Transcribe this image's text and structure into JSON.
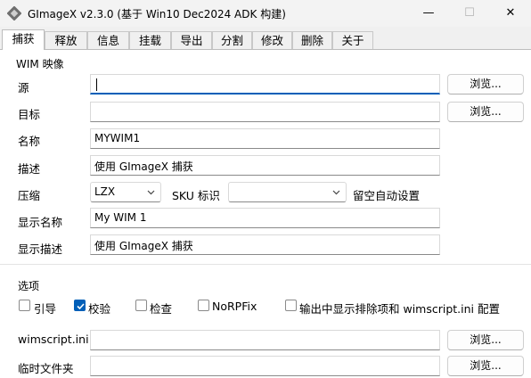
{
  "window": {
    "title": "GImageX v2.3.0 (基于 Win10 Dec2024 ADK 构建)",
    "minimize": "—",
    "maximize": "☐",
    "close": "✕"
  },
  "tabs": [
    {
      "label": "捕获",
      "active": true
    },
    {
      "label": "释放"
    },
    {
      "label": "信息"
    },
    {
      "label": "挂载"
    },
    {
      "label": "导出"
    },
    {
      "label": "分割"
    },
    {
      "label": "修改"
    },
    {
      "label": "删除"
    },
    {
      "label": "关于"
    }
  ],
  "wim_group": {
    "title": "WIM 映像",
    "source": {
      "label": "源",
      "value": ""
    },
    "target": {
      "label": "目标",
      "value": ""
    },
    "name": {
      "label": "名称",
      "value": "MYWIM1"
    },
    "description": {
      "label": "描述",
      "value": "使用 GImageX 捕获"
    },
    "compression": {
      "label": "压缩",
      "value": "LZX"
    },
    "sku": {
      "label": "SKU 标识",
      "value": "",
      "hint": "留空自动设置"
    },
    "display_name": {
      "label": "显示名称",
      "value": "My WIM 1"
    },
    "display_description": {
      "label": "显示描述",
      "value": "使用 GImageX 捕获"
    },
    "browse_label": "浏览..."
  },
  "options_group": {
    "title": "选项",
    "checkboxes": [
      {
        "label": "引导",
        "checked": false
      },
      {
        "label": "校验",
        "checked": true
      },
      {
        "label": "检查",
        "checked": false
      },
      {
        "label": "NoRPFix",
        "checked": false
      },
      {
        "label": "输出中显示排除项和 wimscript.ini 配置",
        "checked": false
      }
    ],
    "wimscript": {
      "label": "wimscript.ini",
      "value": ""
    },
    "temp_folder": {
      "label": "临时文件夹",
      "value": ""
    },
    "browse_label": "浏览..."
  },
  "colors": {
    "accent": "#005fb8",
    "panel": "#ffffff",
    "window": "#f0f0f0"
  }
}
